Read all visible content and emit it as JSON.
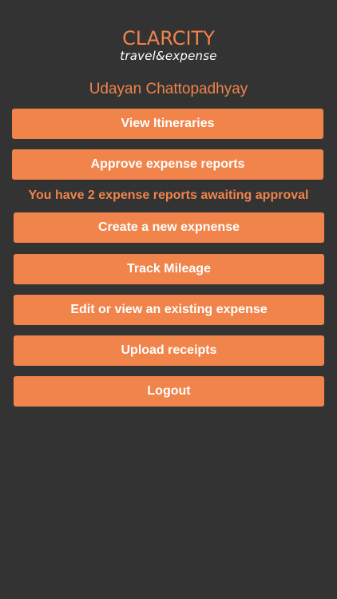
{
  "logo": {
    "brand": "CLARCITY",
    "tagline": "travel&expense"
  },
  "user": {
    "name": "Udayan Chattopadhyay"
  },
  "menu": {
    "view_itineraries": "View Itineraries",
    "approve_expense_reports": "Approve expense reports",
    "approval_notice": "You have 2 expense reports awaiting approval",
    "create_new_expense": "Create a new expnense",
    "track_mileage": "Track Mileage",
    "edit_existing_expense": "Edit or view an existing expense",
    "upload_receipts": "Upload receipts",
    "logout": "Logout"
  },
  "colors": {
    "background": "#333333",
    "accent": "#F0844B",
    "button_text": "#FFFFFF"
  }
}
